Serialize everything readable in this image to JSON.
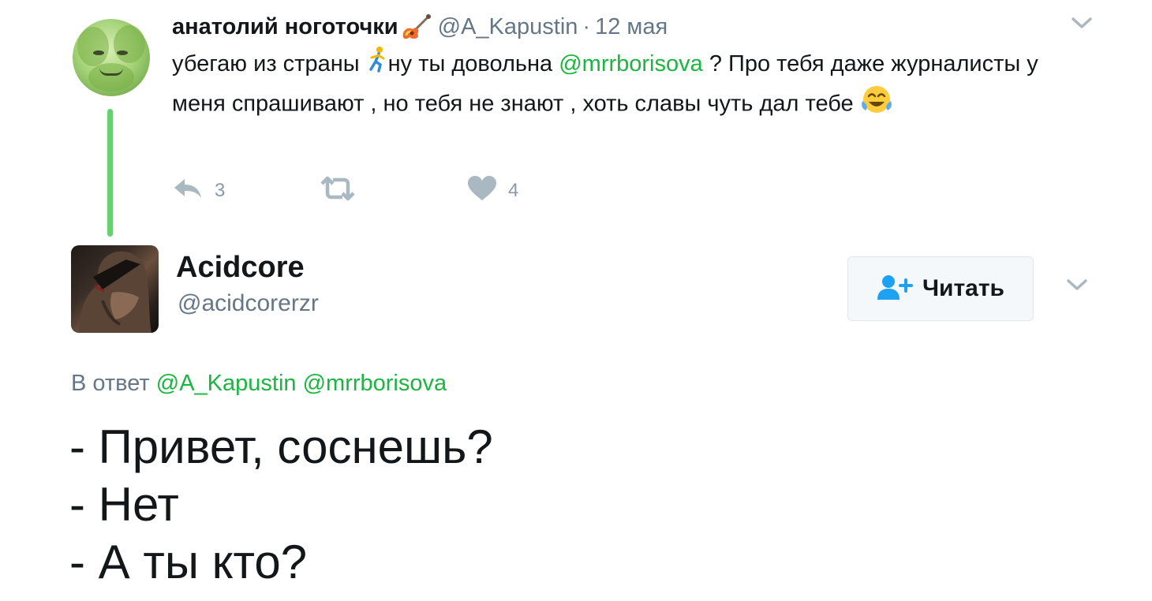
{
  "parent_tweet": {
    "author_name": "анатолий ноготочки",
    "author_emoji": "guitar-icon",
    "handle": "@A_Kapustin",
    "separator": "·",
    "date": "12 мая",
    "text_part1": "убегаю из страны ",
    "text_emoji1": "running-person-icon",
    "text_part2": "ну ты довольна ",
    "mention": "@mrrborisova",
    "text_part3": " ? Про тебя даже журналисты у меня спрашивают , но тебя не знают , хоть славы чуть дал тебе ",
    "text_emoji2": "tears-of-joy-icon",
    "reply_count": "3",
    "retweet_count": "",
    "like_count": "4"
  },
  "reply_tweet": {
    "author_name": "Acidcore",
    "handle": "@acidcorerzr",
    "follow_label": "Читать",
    "reply_prefix": "В ответ",
    "reply_mention_1": "@A_Kapustin",
    "reply_mention_2": "@mrrborisova",
    "lines": [
      "- Привет, соснешь?",
      "- Нет",
      "- А ты кто?"
    ]
  },
  "colors": {
    "accent": "#19b640",
    "thread_line": "#66d26f",
    "secondary_text": "#657786",
    "action_icon": "#aab8c2"
  }
}
